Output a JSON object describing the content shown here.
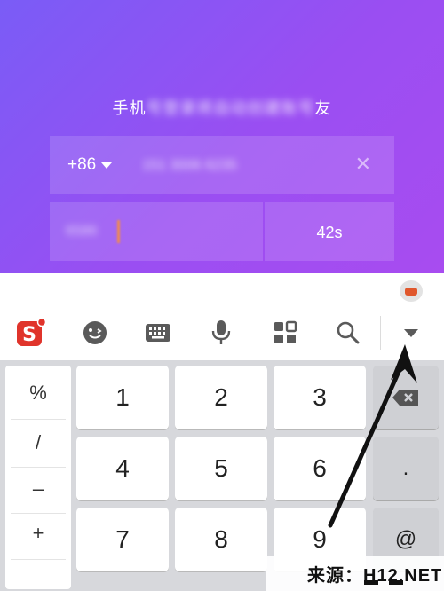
{
  "login": {
    "hint_prefix": "手机",
    "hint_blur": "号登录将自动创建账号",
    "hint_suffix": "友",
    "country_code": "+86",
    "phone_value": "151 3006 6235",
    "code_value": "6586",
    "countdown": "42s"
  },
  "keyboard": {
    "symbols": [
      "%",
      "/",
      "–",
      "+"
    ],
    "digits": [
      [
        "1",
        "2",
        "3"
      ],
      [
        "4",
        "5",
        "6"
      ],
      [
        "7",
        "8",
        "9"
      ]
    ],
    "dot": ".",
    "at": "@",
    "toolbar_icons": [
      "sogou-logo-icon",
      "emoji-icon",
      "keyboard-icon",
      "microphone-icon",
      "grid-apps-icon",
      "search-icon",
      "collapse-arrow-icon"
    ]
  },
  "watermark": {
    "text": "来源：H12.NET"
  },
  "colors": {
    "gradient_start": "#7a5cf6",
    "gradient_end": "#a84cf0",
    "sogou_red": "#e0342b"
  }
}
